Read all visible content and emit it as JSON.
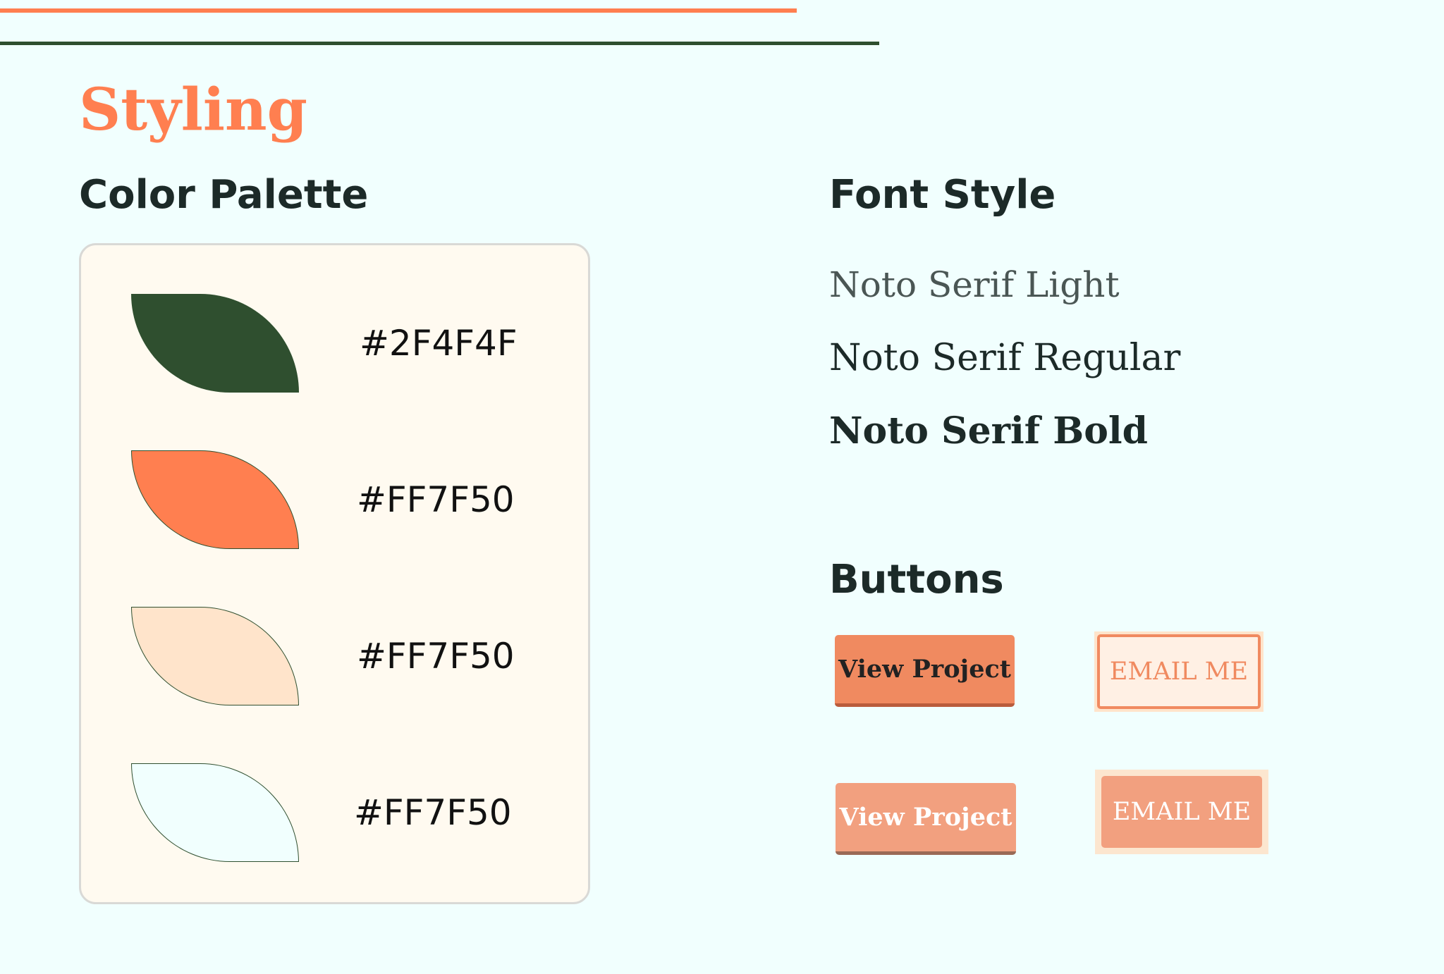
{
  "title": "Styling",
  "color_palette": {
    "heading": "Color Palette",
    "swatches": [
      {
        "hex_label": "#2F4F4F",
        "fill": "#2F4F2F"
      },
      {
        "hex_label": "#FF7F50",
        "fill": "#FF7F50"
      },
      {
        "hex_label": "#FF7F50",
        "fill": "#FFE4CB"
      },
      {
        "hex_label": "#FF7F50",
        "fill": "#F1FFFE"
      }
    ]
  },
  "font_style": {
    "heading": "Font Style",
    "samples": [
      "Noto Serif Light",
      "Noto Serif Regular",
      "Noto Serif Bold"
    ]
  },
  "buttons": {
    "heading": "Buttons",
    "view_project_label": "View Project",
    "email_me_label": "EMAIL ME"
  },
  "colors": {
    "accent": "#FF7F50",
    "dark_green": "#2F4F2F",
    "background": "#F1FFFE",
    "card_background": "#FFFAF0"
  }
}
